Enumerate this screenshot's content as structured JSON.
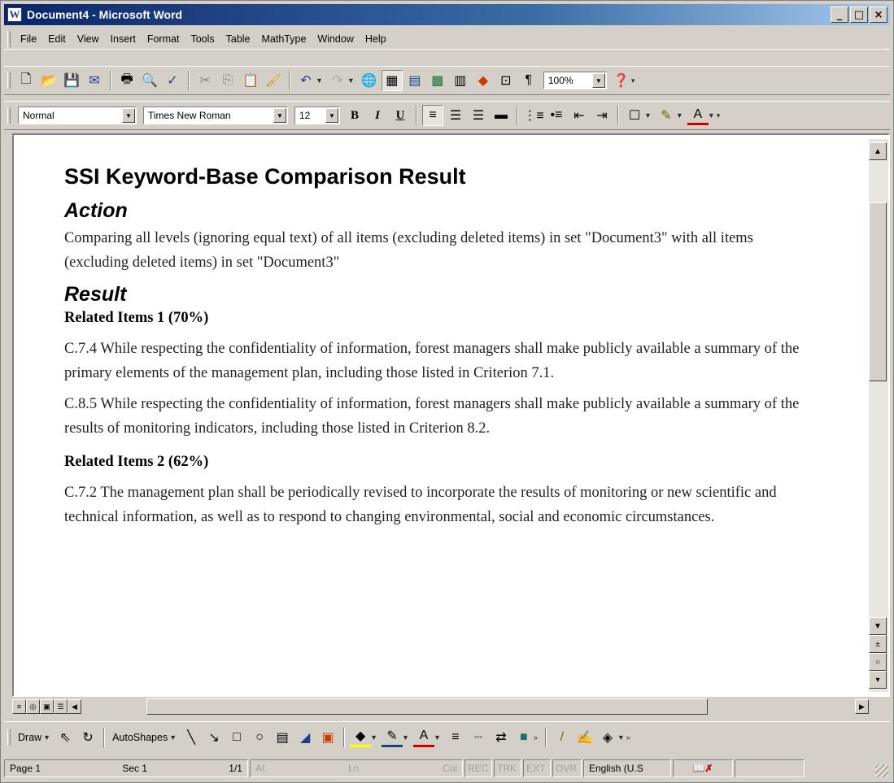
{
  "window": {
    "title": "Document4 - Microsoft Word",
    "min": "_",
    "max": "□",
    "close": "×"
  },
  "menu": [
    "File",
    "Edit",
    "View",
    "Insert",
    "Format",
    "Tools",
    "Table",
    "MathType",
    "Window",
    "Help"
  ],
  "standard_toolbar": {
    "zoom": "100%"
  },
  "formatting_toolbar": {
    "style": "Normal",
    "font": "Times New Roman",
    "size": "12"
  },
  "document": {
    "title": "SSI Keyword-Base Comparison Result",
    "action_heading": "Action",
    "action_text": "Comparing all levels (ignoring equal text) of all items (excluding deleted items) in set \"Document3\" with all items (excluding deleted items) in set \"Document3\"",
    "result_heading": "Result",
    "groups": [
      {
        "heading": "Related Items 1 (70%)",
        "items": [
          "C.7.4 While respecting the confidentiality of information, forest managers shall make publicly available a summary of the primary elements of the management plan, including those listed in Criterion 7.1.",
          "C.8.5 While respecting the confidentiality of information, forest managers shall make publicly available a summary of the results of monitoring indicators, including those listed in Criterion 8.2."
        ]
      },
      {
        "heading": "Related Items 2 (62%)",
        "items": [
          "C.7.2 The management plan shall be periodically revised to incorporate the results of monitoring or new scientific and technical information, as well as to respond to changing environmental, social and economic circumstances."
        ]
      }
    ]
  },
  "drawing_toolbar": {
    "draw": "Draw",
    "autoshapes": "AutoShapes"
  },
  "status": {
    "page": "Page 1",
    "sec": "Sec 1",
    "pages": "1/1",
    "at": "At",
    "ln": "Ln",
    "col": "Col",
    "rec": "REC",
    "trk": "TRK",
    "ext": "EXT",
    "ovr": "OVR",
    "language": "English (U.S"
  }
}
